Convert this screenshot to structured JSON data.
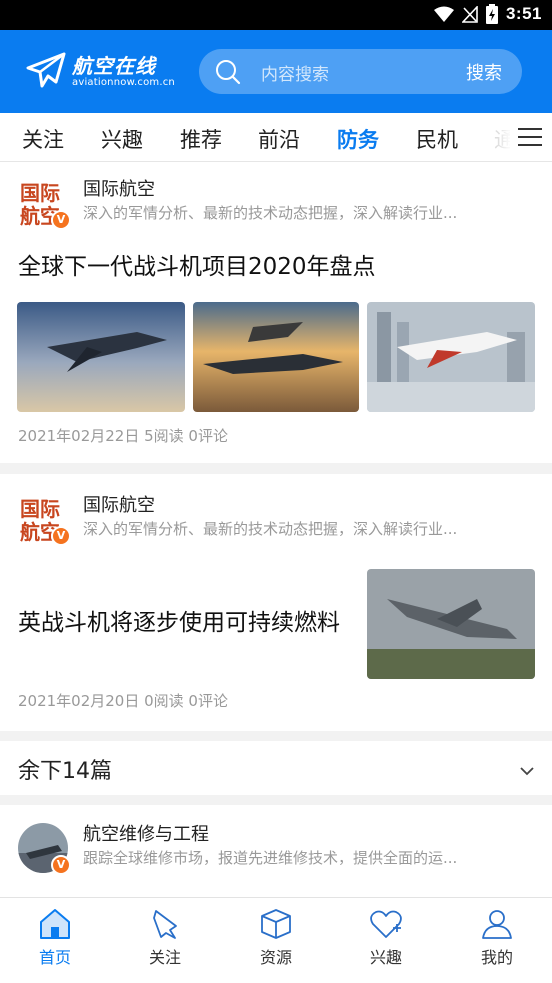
{
  "status_bar": {
    "time": "3:51"
  },
  "header": {
    "logo_name": "航空在线",
    "logo_url": "aviationnow.com.cn",
    "search_placeholder": "内容搜索",
    "search_button": "搜索"
  },
  "tabs": [
    "关注",
    "兴趣",
    "推荐",
    "前沿",
    "防务",
    "民机",
    "通"
  ],
  "active_tab": "防务",
  "articles": [
    {
      "author": "国际航空",
      "avatar_text": "国际航空",
      "author_desc": "深入的军情分析、最新的技术动态把握，深入解读行业...",
      "title": "全球下一代战斗机项目2020年盘点",
      "meta": "2021年02月22日 5阅读 0评论"
    },
    {
      "author": "国际航空",
      "avatar_text": "国际航空",
      "author_desc": "深入的军情分析、最新的技术动态把握，深入解读行业...",
      "title": "英战斗机将逐步使用可持续燃料",
      "meta": "2021年02月20日 0阅读 0评论"
    },
    {
      "author": "航空维修与工程",
      "author_desc": "跟踪全球维修市场，报道先进维修技术，提供全面的运..."
    }
  ],
  "more_label": "余下14篇",
  "badge_mark": "V",
  "bottom_nav": [
    "首页",
    "关注",
    "资源",
    "兴趣",
    "我的"
  ],
  "colors": {
    "brand": "#0a7cf0",
    "badge": "#f5731f"
  }
}
